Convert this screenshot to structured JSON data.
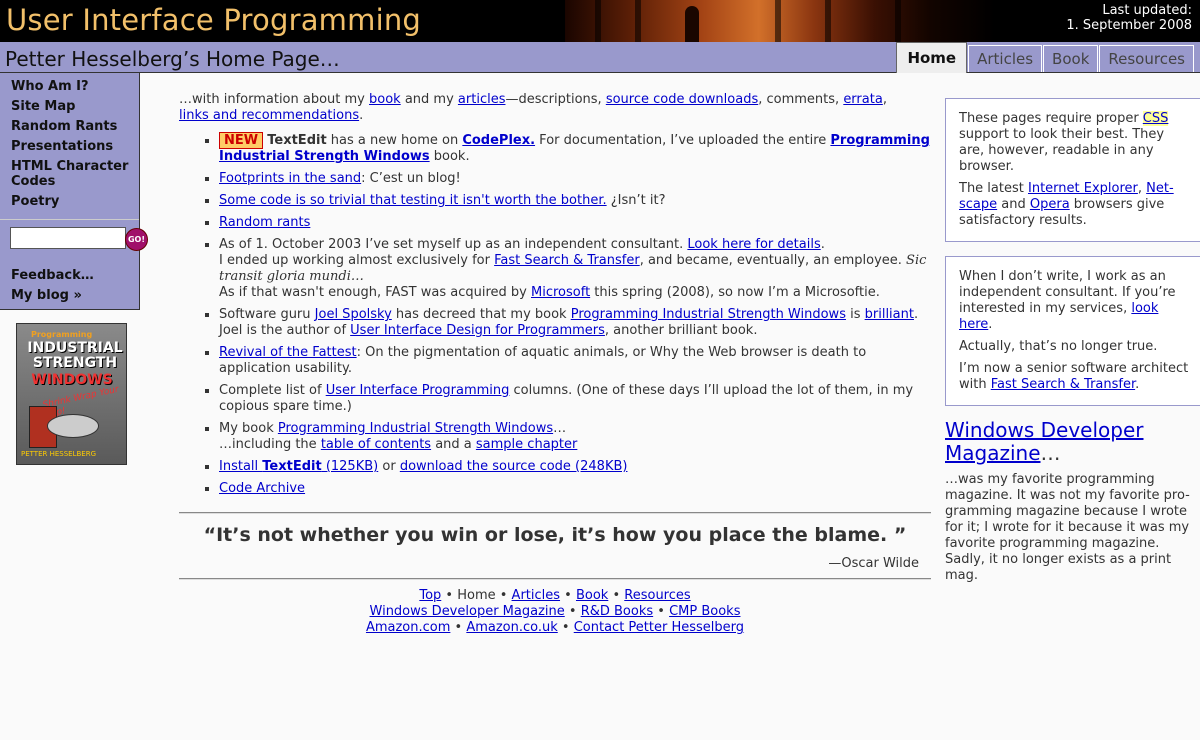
{
  "header": {
    "site_title": "User Interface Programming",
    "updated_label": "Last updated:",
    "updated_date": "1. September 2008",
    "page_title": "Petter Hesselberg’s Home Page…",
    "tabs": [
      {
        "label": "Home",
        "active": true
      },
      {
        "label": "Articles",
        "active": false
      },
      {
        "label": "Book",
        "active": false
      },
      {
        "label": "Resources",
        "active": false
      }
    ]
  },
  "sidebar": {
    "items": [
      "Who Am I?",
      "Site Map",
      "Random Rants",
      "Presentations",
      "HTML Character Codes",
      "Poetry"
    ],
    "search_placeholder": "",
    "go_label": "GO!",
    "feedback": "Feedback…",
    "blog": "My blog »"
  },
  "cover": {
    "line1": "Programming",
    "line2": "INDUSTRIAL STRENGTH",
    "line3": "WINDOWS",
    "tagline": "Shrink Wrap Your App!",
    "author": "PETTER HESSELBERG"
  },
  "main": {
    "intro": {
      "t1": "…with information about my ",
      "book": "book",
      "t2": " and my ",
      "articles": "articles",
      "t3": "—descriptions, ",
      "downloads": "source code downloads",
      "t4": ", comments, ",
      "errata": "errata",
      "t5": ",",
      "links": "links and recommendations",
      "t6": "."
    },
    "news": {
      "n1": {
        "badge": "NEW",
        "textedit": "TextEdit",
        "t1": " has a new home on ",
        "codeplex": "CodePlex.",
        "t2": " For documentation, I’ve uploaded the entire ",
        "book": "Programming Industrial Strength Windows",
        "t3": " book."
      },
      "n2": {
        "link": "Footprints in the sand",
        "t1": ": C’est un blog!"
      },
      "n3": {
        "link": "Some code is so trivial that testing it isn't worth the bother.",
        "t1": " ¿Isn’t it?"
      },
      "n4": {
        "link": "Random rants"
      },
      "n5": {
        "t1": "As of 1. October 2003 I’ve set myself up as an independent consultant. ",
        "details": "Look here for details",
        "t2": ".",
        "t3": "I ended up working almost exclusively for ",
        "fast": "Fast Search & Transfer",
        "t4": ", and became, eventually, an employee. ",
        "latin": "Sic transit gloria mundi…",
        "t5": "As if that wasn't enough, FAST was acquired by ",
        "microsoft": "Microsoft",
        "t6": " this spring (2008), so now I’m a Microsoftie."
      },
      "n6": {
        "t1": "Software guru ",
        "joel": "Joel Spolsky",
        "t2": " has decreed that my book ",
        "book": "Programming Industrial Strength Windows",
        "t3": " is ",
        "brilliant": "brilliant",
        "t4": ".",
        "t5": "Joel is the author of ",
        "uid": "User Interface Design for Programmers",
        "t6": ", another brilliant book."
      },
      "n7": {
        "link": "Revival of the Fattest",
        "t1": ": On the pigmentation of aquatic animals, or Why the Web browser is death to application usability."
      },
      "n8": {
        "t1": "Complete list of ",
        "link": "User Interface Programming",
        "t2": " columns. (One of these days I’ll upload the lot of them, in my copious spare time.)"
      },
      "n9": {
        "t1": "My book ",
        "book": "Programming Industrial Strength Windows",
        "t2": "…",
        "t3": "…including the ",
        "toc": "table of contents",
        "t4": " and a ",
        "sample": "sample chapter"
      },
      "n10": {
        "install": "Install ",
        "textedit": "TextEdit",
        "size1": " (125KB)",
        "t1": " or ",
        "download": "download the source code (248KB)"
      },
      "n11": {
        "link": "Code Archive"
      }
    },
    "quote": "“It’s not whether you win or lose, it’s how you place the blame. ”",
    "quote_author": "—Oscar Wilde"
  },
  "footer": {
    "top": "Top",
    "home": "Home",
    "articles": "Articles",
    "book": "Book",
    "resources": "Resources",
    "wdm": "Windows Developer Magazine",
    "rd": "R&D Books",
    "cmp": "CMP Books",
    "amazon_com": "Amazon.com",
    "amazon_uk": "Amazon.co.uk",
    "contact": "Contact Petter Hesselberg",
    "bullet": " • "
  },
  "right": {
    "box1": {
      "t1": "These pages require proper ",
      "css": "CSS",
      "t2": " support to look their best. They are, however, readable in any browser.",
      "t3": "The latest ",
      "ie": "Internet Explorer",
      "t4": ", ",
      "ns": "Net-scape",
      "t5": " and ",
      "opera": "Opera",
      "t6": " browsers give satisfactory results."
    },
    "box2": {
      "t1": "When I don’t write, I work as an independent consultant. If you’re interested in my services, ",
      "here": "look here",
      "t2": ".",
      "t3": "Actually, that’s no longer true.",
      "t4": "I’m now a senior software architect with ",
      "fast": "Fast Search & Transfer",
      "t5": "."
    },
    "wdm_title": "Windows Developer Magazine",
    "wdm_ellipsis": "…",
    "wdm_text": "…was my favorite programming magazine. It was not my favorite pro-gramming magazine because I wrote for it; I wrote for it because it was my favorite programming magazine. Sadly, it no longer exists as a print mag."
  }
}
